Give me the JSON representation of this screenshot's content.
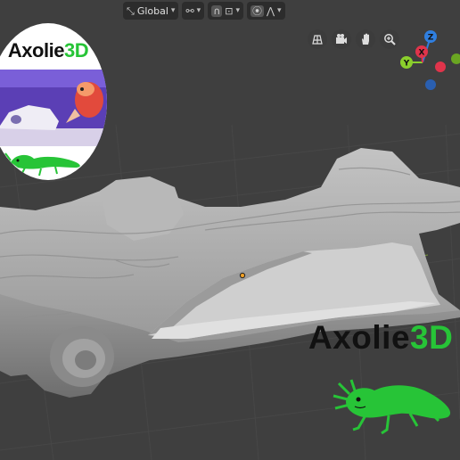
{
  "header": {
    "orientation_label": "Global",
    "icons": [
      "transform-orientation-icon",
      "pivot-icon",
      "snap-icon",
      "snap-target-icon",
      "proportional-edit-icon",
      "falloff-icon"
    ]
  },
  "navigation": {
    "buttons": [
      "grid-view-icon",
      "camera-icon",
      "hand-pan-icon",
      "zoom-icon"
    ]
  },
  "gizmo": {
    "axes": [
      {
        "label": "Z",
        "color": "#2f7fe0"
      },
      {
        "label": "Y",
        "color": "#8bcf2c"
      },
      {
        "label": "X",
        "color": "#e0344b"
      }
    ]
  },
  "logo_badge": {
    "brand_prefix": "Axolie",
    "brand_suffix": "3D"
  },
  "watermark": {
    "brand_prefix": "Axolie",
    "brand_suffix": "3D"
  },
  "colors": {
    "viewport_bg": "#3f3f3f",
    "grid_line": "#4a4a4a",
    "brand_green": "#27c437",
    "mesh_gray": "#a9a9a9"
  }
}
